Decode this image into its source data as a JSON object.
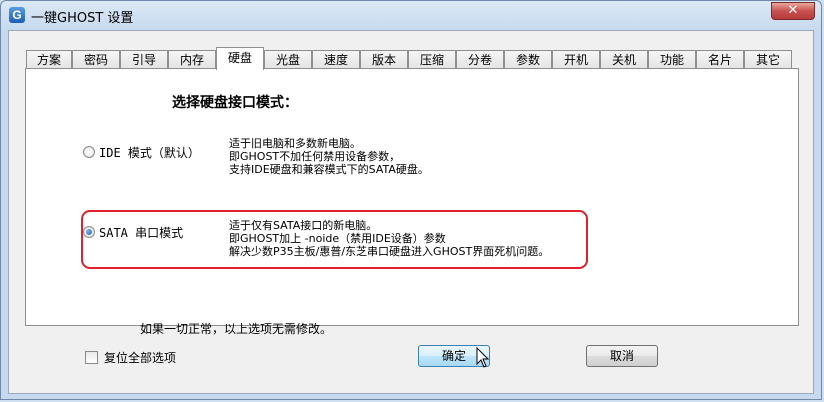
{
  "window": {
    "title": "一键GHOST 设置",
    "app_icon": "G",
    "close": "✕"
  },
  "tabs": [
    "方案",
    "密码",
    "引导",
    "内存",
    "硬盘",
    "光盘",
    "速度",
    "版本",
    "压缩",
    "分卷",
    "参数",
    "开机",
    "关机",
    "功能",
    "名片",
    "其它"
  ],
  "active_tab": "硬盘",
  "panel": {
    "heading": "选择硬盘接口模式：",
    "options": [
      {
        "label": "IDE 模式（默认）",
        "selected": false,
        "desc": [
          "适于旧电脑和多数新电脑。",
          "即GHOST不加任何禁用设备参数，",
          "支持IDE硬盘和兼容模式下的SATA硬盘。"
        ]
      },
      {
        "label": "SATA 串口模式",
        "selected": true,
        "desc": [
          "适于仅有SATA接口的新电脑。",
          "即GHOST加上 -noide（禁用IDE设备）参数",
          "解决少数P35主板/惠普/东芝串口硬盘进入GHOST界面死机问题。"
        ]
      }
    ],
    "note": "如果一切正常，以上选项无需修改。",
    "highlight_color": "#e0202a"
  },
  "footer": {
    "reset_label": "复位全部选项",
    "reset_checked": false,
    "ok_label": "确定",
    "cancel_label": "取消"
  }
}
